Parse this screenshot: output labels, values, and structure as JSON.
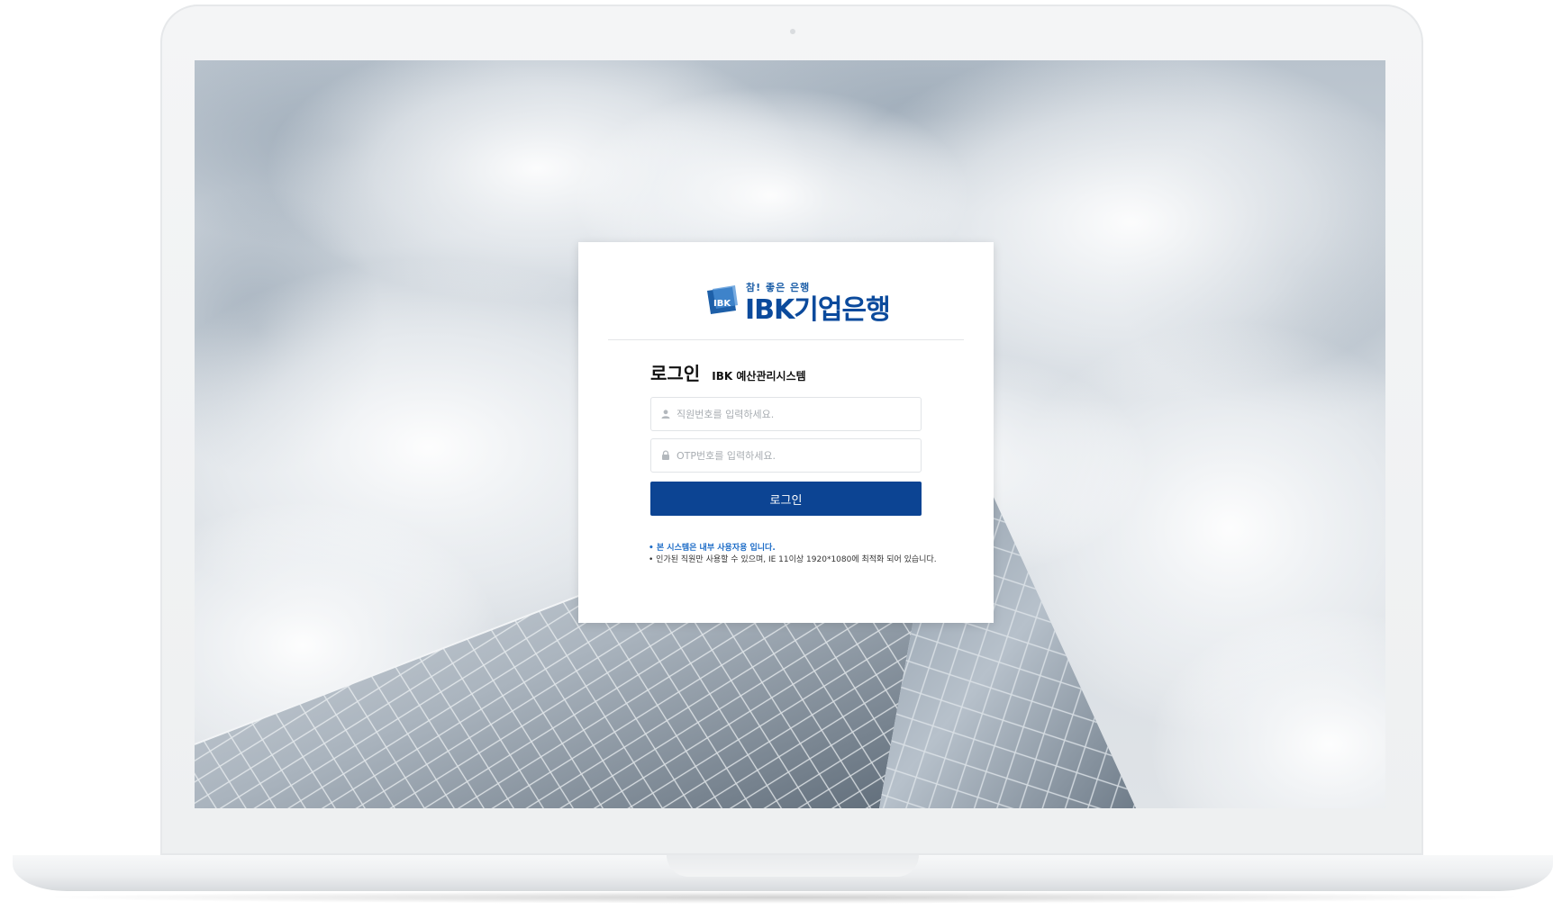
{
  "brand": {
    "tagline": "참! 좋은 은행",
    "name": "IBK기업은행",
    "mark_text": "IBK",
    "color_primary": "#0b4a9c"
  },
  "login": {
    "title": "로그인",
    "system_name": "IBK 예산관리시스템",
    "employee_id_placeholder": "직원번호를 입력하세요.",
    "otp_placeholder": "OTP번호를 입력하세요.",
    "employee_icon": "user-icon",
    "otp_icon": "lock-icon",
    "submit_label": "로그인",
    "submit_color": "#0c4493"
  },
  "notices": {
    "line1": "• 본 시스템은 내부 사용자용 입니다.",
    "line2": "• 인가된 직원만 사용할 수 있으며, IE 11이상 1920*1080에 최적화 되어 있습니다."
  }
}
